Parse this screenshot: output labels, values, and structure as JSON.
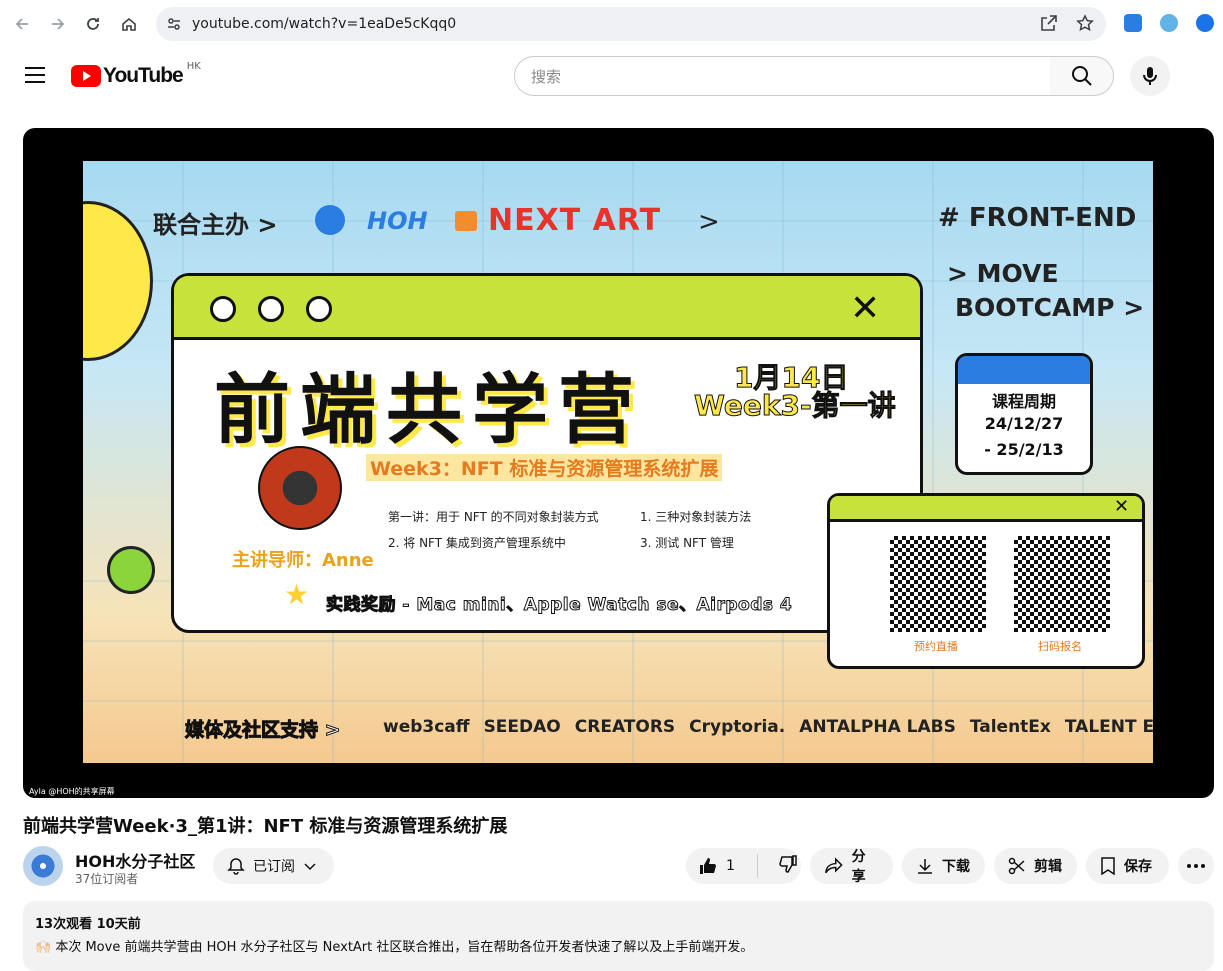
{
  "browser": {
    "url": "youtube.com/watch?v=1eaDe5cKqq0",
    "icons": [
      "back-icon",
      "forward-icon",
      "reload-icon",
      "home-icon",
      "site-info-icon",
      "open-in-app-icon",
      "bookmark-star-icon"
    ]
  },
  "header": {
    "logo_text": "YouTube",
    "region": "HK",
    "search_placeholder": "搜索"
  },
  "video_frame": {
    "organizer_label": "联合主办 >",
    "org1": "HOH",
    "org2": "NEXT ART",
    "tag1": "# FRONT-END",
    "tag2": "> MOVE",
    "tag3": "BOOTCAMP >",
    "main_title": "前端共学营",
    "date": "1月14日",
    "week": "Week3-第一讲",
    "subtitle": "Week3：NFT 标准与资源管理系统扩展",
    "lecturer": "主讲导师：Anne",
    "point1": "第一讲：用于 NFT 的不同对象封装方式",
    "point2": "1. 三种对象封装方法",
    "point3": "2. 将 NFT 集成到资产管理系统中",
    "point4": "3. 测试 NFT 管理",
    "reward": "实践奖励 - Mac mini、Apple Watch se、Airpods 4",
    "course_period_label": "课程周期",
    "course_start": "24/12/27",
    "course_end": "- 25/2/13",
    "qr1_label": "预约直播",
    "qr2_label": "扫码报名",
    "sponsors_label": "媒体及社区支持 >",
    "sponsors": [
      "web3caff",
      "SEEDAO",
      "CREATORS",
      "Cryptoria.",
      "ANTALPHA LABS",
      "TalentEx",
      "TALENT ERA"
    ],
    "watermark": "Ayla @HOH的共享屏幕"
  },
  "video": {
    "title": "前端共学营Week·3_第1讲：NFT 标准与资源管理系统扩展",
    "channel": "HOH水分子社区",
    "subscribers": "37位订阅者",
    "subscribed_label": "已订阅",
    "like_count": "1",
    "share_label": "分享",
    "download_label": "下载",
    "clip_label": "剪辑",
    "save_label": "保存"
  },
  "description": {
    "stats": "13次观看  10天前",
    "text": "🙌🏻 本次 Move 前端共学营由 HOH 水分子社区与 NextArt 社区联合推出，旨在帮助各位开发者快速了解以及上手前端开发。"
  },
  "colors": {
    "youtube_red": "#ff0000",
    "next_art_red": "#e8322a",
    "hoh_blue": "#2a7de1",
    "lime": "#c8e23c",
    "sun_yellow": "#ffe84a"
  }
}
